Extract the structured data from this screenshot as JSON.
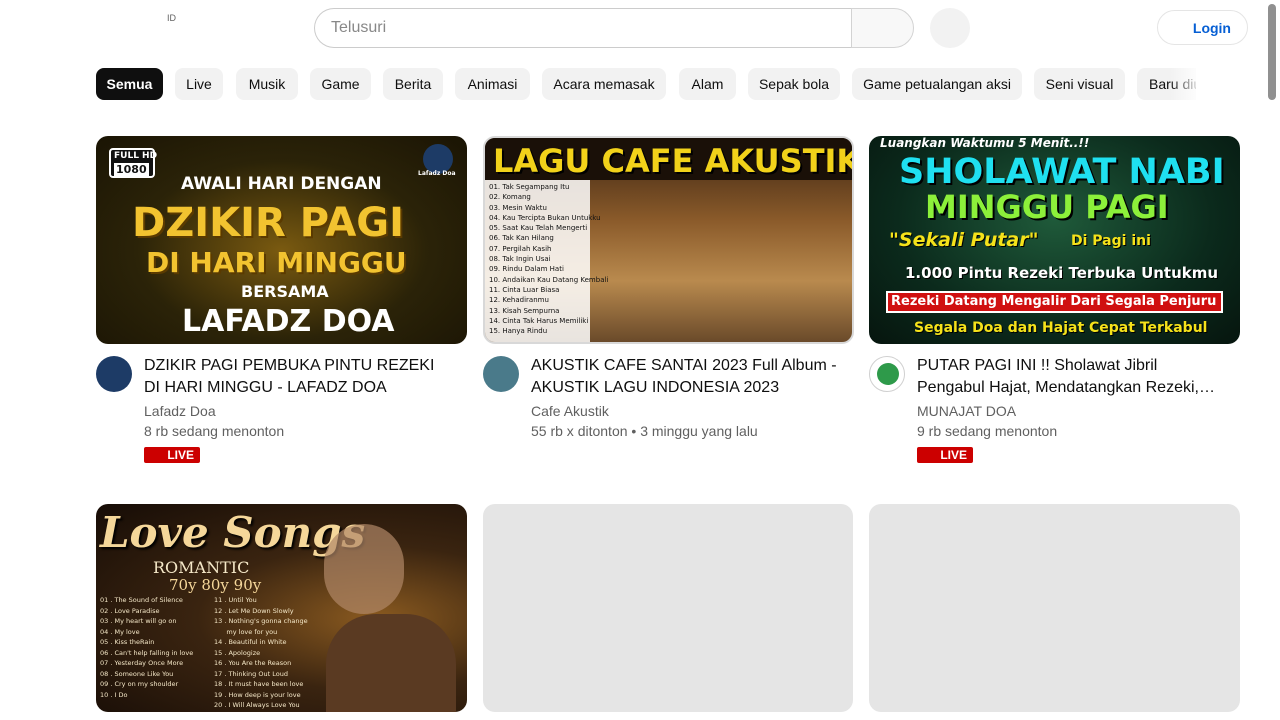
{
  "header": {
    "country_code": "ID",
    "search_placeholder": "Telusuri",
    "login_label": "Login"
  },
  "chips": [
    {
      "label": "Semua",
      "active": true
    },
    {
      "label": "Live"
    },
    {
      "label": "Musik"
    },
    {
      "label": "Game"
    },
    {
      "label": "Berita"
    },
    {
      "label": "Animasi"
    },
    {
      "label": "Acara memasak"
    },
    {
      "label": "Alam"
    },
    {
      "label": "Sepak bola"
    },
    {
      "label": "Game petualangan aksi"
    },
    {
      "label": "Seni visual"
    },
    {
      "label": "Baru diu"
    }
  ],
  "videos": [
    {
      "title": "DZIKIR PAGI PEMBUKA PINTU REZEKI DI HARI MINGGU - LAFADZ DOA",
      "channel": "Lafadz Doa",
      "meta": "8 rb sedang menonton",
      "badge": "LIVE",
      "thumb": {
        "hd1": "FULL HD",
        "hd2": "1080",
        "brand": "Lafadz Doa",
        "l1": "AWALI HARI DENGAN",
        "l2": "DZIKIR PAGI",
        "l3": "DI HARI MINGGU",
        "l4": "BERSAMA",
        "l5": "LAFADZ DOA"
      }
    },
    {
      "title": "AKUSTIK CAFE SANTAI 2023 Full Album - AKUSTIK LAGU INDONESIA 2023",
      "channel": "Cafe Akustik",
      "meta": "55 rb x ditonton • 3 minggu yang lalu",
      "thumb": {
        "l1": "LAGU CAFE AKUSTIK",
        "list": "01. Tak Segampang Itu\n02. Komang\n03. Mesin Waktu\n04. Kau Tercipta Bukan Untukku\n05. Saat Kau Telah Mengerti\n06. Tak Kan Hilang\n07. Pergilah Kasih\n08. Tak Ingin Usai\n09. Rindu Dalam Hati\n10. Andaikan Kau Datang Kembali\n11. Cinta Luar Biasa\n12. Kehadiranmu\n13. Kisah Sempurna\n14. Cinta Tak Harus Memiliki\n15. Hanya Rindu"
      }
    },
    {
      "title": "PUTAR PAGI INI !! Sholawat Jibril Pengabul Hajat, Mendatangkan Rezeki, Kesehatan Dan Keberkahan",
      "channel": "MUNAJAT DOA",
      "meta": "9 rb sedang menonton",
      "badge": "LIVE",
      "thumb": {
        "l0": "Luangkan Waktumu 5 Menit..!!",
        "l1": "SHOLAWAT NABI",
        "l2": "MINGGU PAGI",
        "l3": "\"Sekali Putar\"",
        "l3b": "Di Pagi ini",
        "l4": "1.000 Pintu Rezeki Terbuka Untukmu",
        "l5": "Rezeki Datang Mengalir Dari Segala Penjuru",
        "l6": "Segala Doa dan Hajat Cepat Terkabul"
      }
    },
    {
      "thumb": {
        "l1": "Love Songs",
        "l2": "ROMANTIC",
        "l3": "70y 80y 90y",
        "list_a": "01 . The Sound of Silence\n02 . Love Paradise\n03 . My heart will go on\n04 . My love\n05 . Kiss theRain\n06 . Can't help falling in love\n07 . Yesterday Once More\n08 . Someone Like You\n09 . Cry on my shoulder\n10 . I Do",
        "list_b": "11 . Until You\n12 . Let Me Down Slowly\n13 . Nothing's gonna change\n      my love for you\n14 . Beautiful in White\n15 . Apologize\n16 . You Are the Reason\n17 . Thinking Out Loud\n18 . It must have been love\n19 . How deep is your love\n20 . I Will Always Love You"
      }
    },
    {
      "placeholder": true
    },
    {
      "placeholder": true
    }
  ]
}
